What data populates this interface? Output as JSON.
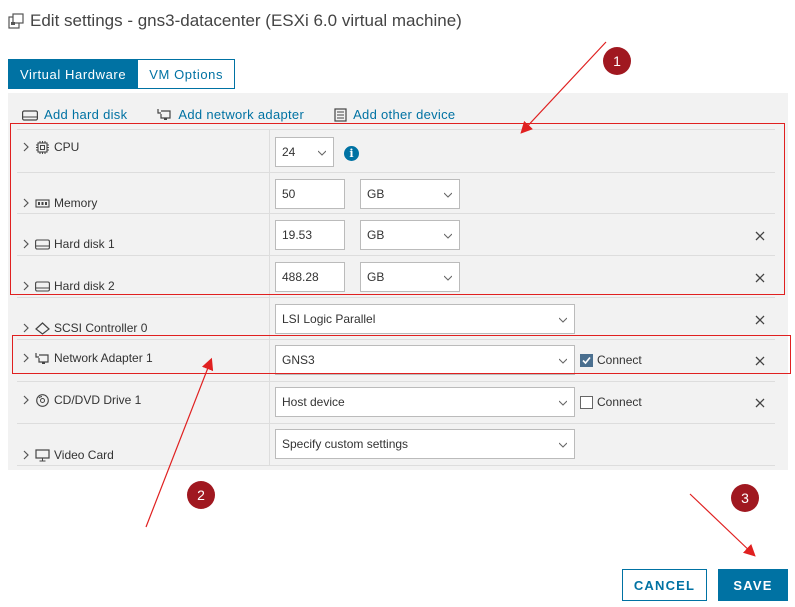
{
  "dialog": {
    "title": "Edit settings - gns3-datacenter (ESXi 6.0 virtual machine)"
  },
  "tabs": [
    {
      "label": "Virtual Hardware",
      "active": true
    },
    {
      "label": "VM Options",
      "active": false
    }
  ],
  "add_bar": {
    "hard_disk": "Add hard disk",
    "network_adapter": "Add network adapter",
    "other_device": "Add other device"
  },
  "hardware": {
    "cpu": {
      "label": "CPU",
      "value": "24"
    },
    "memory": {
      "label": "Memory",
      "value": "50",
      "unit": "GB"
    },
    "hard_disk_1": {
      "label": "Hard disk 1",
      "value": "19.53",
      "unit": "GB"
    },
    "hard_disk_2": {
      "label": "Hard disk 2",
      "value": "488.28",
      "unit": "GB"
    },
    "scsi": {
      "label": "SCSI Controller 0",
      "value": "LSI Logic Parallel"
    },
    "network_adapter_1": {
      "label": "Network Adapter 1",
      "value": "GNS3",
      "connect_label": "Connect",
      "connected": true
    },
    "cd_dvd_1": {
      "label": "CD/DVD Drive 1",
      "value": "Host device",
      "connect_label": "Connect",
      "connected": false
    },
    "video_card": {
      "label": "Video Card",
      "value": "Specify custom settings"
    }
  },
  "annotations": {
    "callout_1": "1",
    "callout_2": "2",
    "callout_3": "3",
    "highlight_color": "#e02020",
    "callout_color": "#a01820"
  },
  "footer": {
    "cancel": "CANCEL",
    "save": "SAVE"
  },
  "colors": {
    "accent": "#0072a3"
  }
}
